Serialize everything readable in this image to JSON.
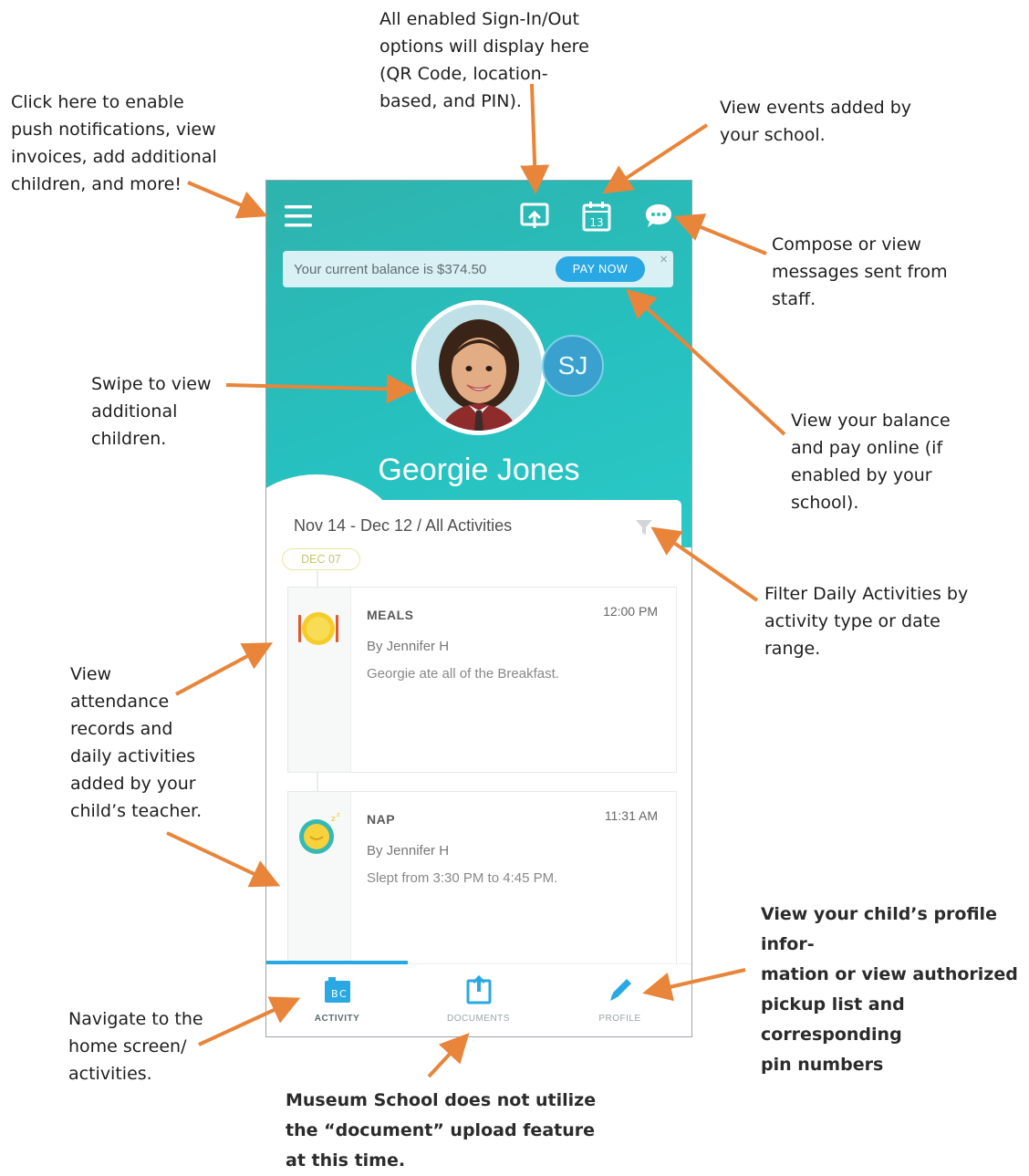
{
  "annotations": {
    "signin": [
      "All enabled Sign-In/Out",
      "options will display here",
      "(QR Code, location-",
      "based, and PIN)."
    ],
    "menu": [
      "Click here to enable",
      "push notifications, view",
      "invoices, add additional",
      "children, and more!"
    ],
    "events": [
      "View events added by",
      "your school."
    ],
    "messages": [
      "Compose or view",
      "messages sent from",
      "staff."
    ],
    "swipe": [
      "Swipe to view",
      "additional",
      "children."
    ],
    "balance": [
      "View your balance",
      "and pay online (if",
      "enabled by your",
      "school)."
    ],
    "filter": [
      "Filter Daily Activities by",
      "activity type or date",
      "range."
    ],
    "records": [
      "View",
      "attendance",
      "records and",
      "daily activities",
      "added by your",
      "child’s teacher."
    ],
    "profile": [
      "View your child’s profile infor-",
      "mation or view authorized",
      "pickup list and corresponding",
      "pin numbers"
    ],
    "home": [
      "Navigate to the",
      "home screen/",
      "activities."
    ],
    "documents": [
      "Museum School does not utilize",
      "the “document” upload feature",
      "at this time."
    ]
  },
  "app": {
    "colors": {
      "header_teal": "#26c0bf",
      "accent_blue": "#2aa8e3",
      "arrow_orange": "#e8853a"
    },
    "topbar": {
      "menu_icon": "hamburger-icon",
      "signin_icon": "sign-in-out-icon",
      "calendar_icon": "calendar-icon",
      "calendar_day": "13",
      "messages_icon": "chat-bubble-icon"
    },
    "balance_banner": {
      "text": "Your current balance is $374.50",
      "pay_label": "PAY NOW",
      "close": "×"
    },
    "child": {
      "name": "Georgie Jones",
      "alt_initials": "SJ"
    },
    "activity": {
      "range": "Nov 14 - Dec 12 / All Activities",
      "date_pill": "DEC 07",
      "items": [
        {
          "type": "MEALS",
          "time": "12:00 PM",
          "by": "By Jennifer H",
          "desc": "Georgie ate all of the Breakfast.",
          "icon": "meal-plate-icon"
        },
        {
          "type": "NAP",
          "time": "11:31 AM",
          "by": "By Jennifer H",
          "desc": "Slept from 3:30 PM to 4:45 PM.",
          "icon": "nap-clock-icon"
        }
      ]
    },
    "tabs": [
      {
        "label": "ACTIVITY",
        "icon": "abc-blocks-icon",
        "active": true
      },
      {
        "label": "DOCUMENTS",
        "icon": "document-upload-icon",
        "active": false
      },
      {
        "label": "PROFILE",
        "icon": "pencil-icon",
        "active": false
      }
    ]
  }
}
